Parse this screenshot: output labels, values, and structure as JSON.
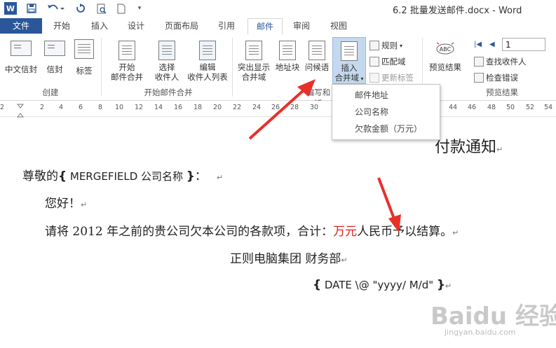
{
  "title_bar": {
    "title": "6.2 批量发送邮件.docx - Word",
    "word_icon": "word-icon",
    "save_icon": "save-icon",
    "undo_icon": "undo-icon",
    "redo_icon": "redo-icon",
    "print_preview_icon": "print-preview-icon",
    "new_doc_icon": "new-document-icon",
    "customize_icon": "customize-qat-icon"
  },
  "tabs": [
    {
      "label": "文件",
      "state": "file"
    },
    {
      "label": "开始"
    },
    {
      "label": "插入"
    },
    {
      "label": "设计"
    },
    {
      "label": "页面布局"
    },
    {
      "label": "引用"
    },
    {
      "label": "邮件",
      "state": "active"
    },
    {
      "label": "审阅"
    },
    {
      "label": "视图"
    }
  ],
  "ribbon": {
    "create": {
      "chinese_envelope": "中文信封",
      "envelope": "信封",
      "labels": "标签",
      "group_label": "创建"
    },
    "start_merge": {
      "start_line1": "开始",
      "start_line2": "邮件合并",
      "select_line1": "选择",
      "select_line2": "收件人",
      "edit_line1": "编辑",
      "edit_line2": "收件人列表",
      "group_label": "开始邮件合并"
    },
    "write_insert": {
      "highlight_line1": "突出显示",
      "highlight_line2": "合并域",
      "address_block": "地址块",
      "greeting": "问候语",
      "insert_line1": "插入",
      "insert_line2": "合并域",
      "rules": "规则",
      "match_fields": "匹配域",
      "update_labels": "更新标签",
      "group_label": "编写和插"
    },
    "preview": {
      "preview_results": "预览结果",
      "record_value": "1",
      "find_recipient": "查找收件人",
      "check_errors": "检查错误",
      "group_label": "预览结果"
    }
  },
  "dropdown": {
    "items": [
      "邮件地址",
      "公司名称",
      "欠款金额（万元）"
    ]
  },
  "ruler": {
    "ticks": [
      "2",
      "2",
      "4",
      "6",
      "8",
      "10",
      "12",
      "14",
      "16",
      "18",
      "20",
      "22",
      "24",
      "26",
      "28",
      "30",
      "44",
      "46",
      "48",
      "50",
      "52",
      "54"
    ]
  },
  "document": {
    "heading": "付款通知",
    "salutation_prefix": "尊敬的",
    "salutation_field_open": "{",
    "salutation_field": " MERGEFIELD  公司名称 ",
    "salutation_field_close": "}",
    "salutation_suffix": "：",
    "greeting": "您好！",
    "body_prefix": "请将 2012 年之前的贵公司欠本公司的各款项，合计：",
    "body_red": "万元",
    "body_suffix": "人民币予以结算。",
    "signature": "正则电脑集团  财务部",
    "date_field_open": "{",
    "date_field": " DATE \\@ \"yyyy/ M/d\" ",
    "date_field_close": "}",
    "paragraph_mark": "↵"
  },
  "watermark": {
    "main": "Baidu 经验",
    "sub": "jingyan.baidu.com"
  },
  "colors": {
    "accent": "#2b579a",
    "arrow": "#e8302a",
    "red_text": "#e0221c"
  }
}
